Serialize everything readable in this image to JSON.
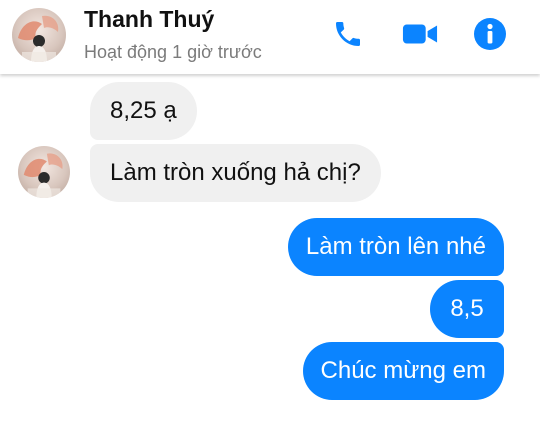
{
  "header": {
    "contact_name": "Thanh Thuý",
    "status": "Hoạt động 1 giờ trước",
    "icons": [
      "phone-icon",
      "video-call-icon",
      "info-icon"
    ],
    "accent_color": "#0b84ff"
  },
  "messages": [
    {
      "sender": "contact",
      "text": "8,25 ạ"
    },
    {
      "sender": "contact",
      "text": "Làm tròn xuống hả chị?"
    },
    {
      "sender": "me",
      "text": "Làm tròn lên nhé"
    },
    {
      "sender": "me",
      "text": "8,5"
    },
    {
      "sender": "me",
      "text": "Chúc mừng em"
    }
  ]
}
